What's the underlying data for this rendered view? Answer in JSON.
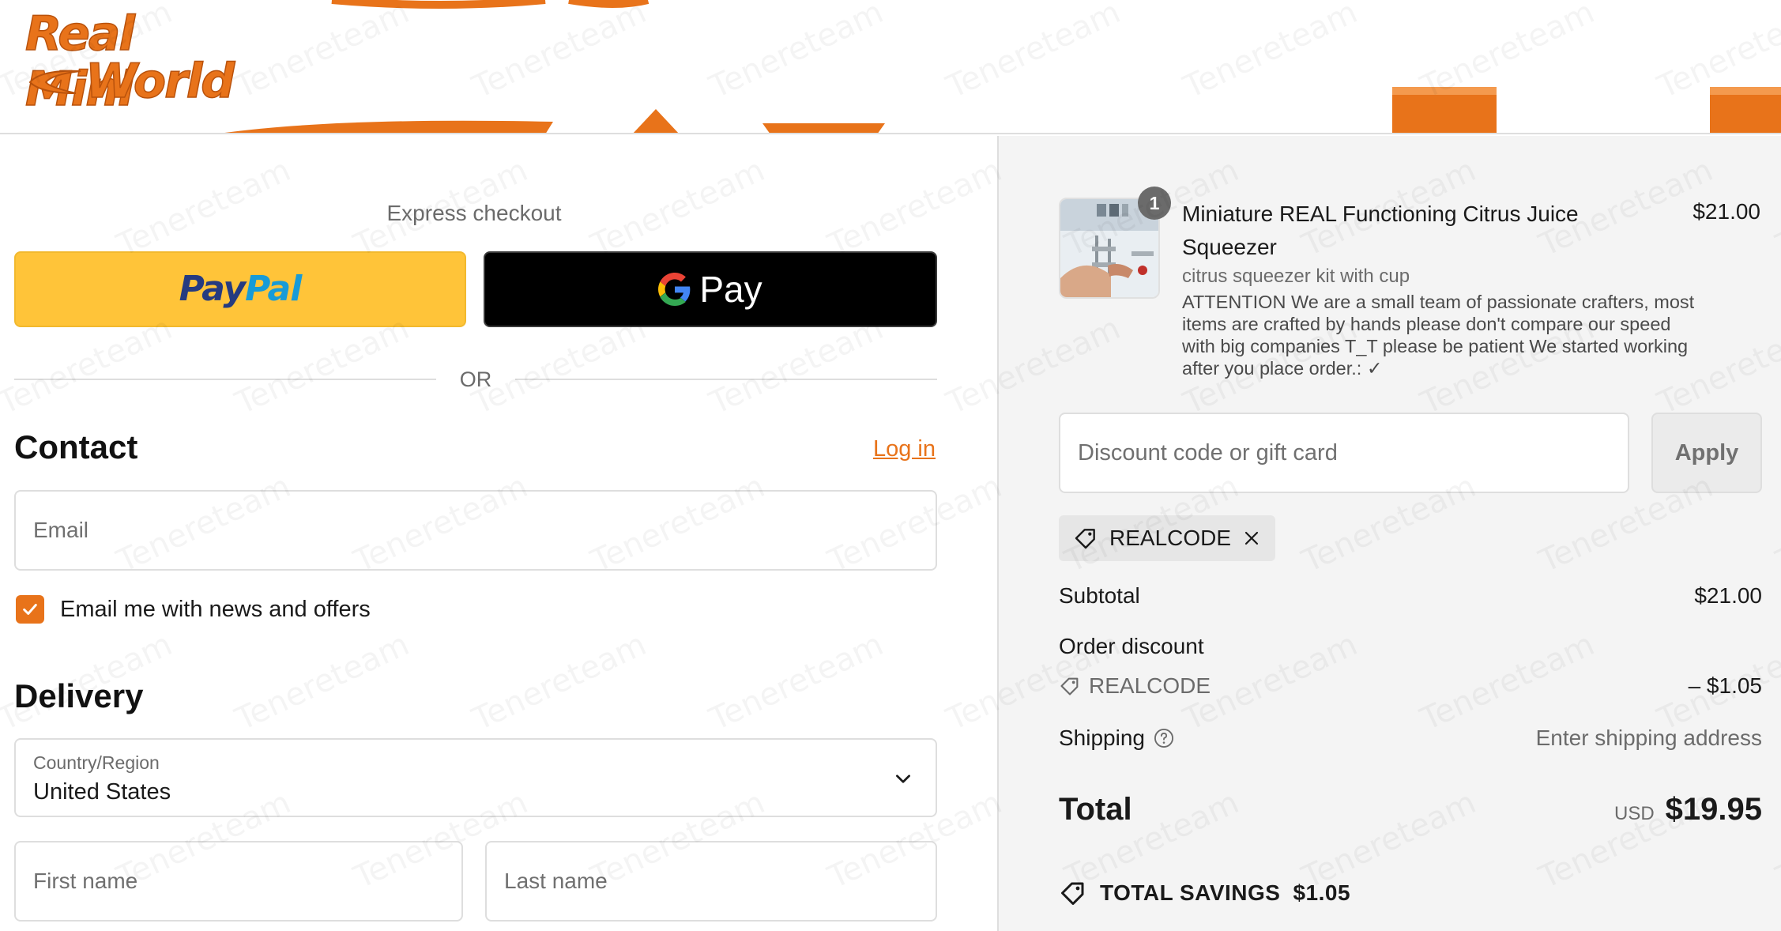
{
  "brand": {
    "logo_line1": "Real Mini",
    "logo_line2": "World",
    "accent_color": "#e8731a"
  },
  "express_checkout": {
    "title": "Express checkout",
    "paypal_label_pay": "Pay",
    "paypal_label_pal": "Pal",
    "gpay_label": "Pay",
    "or_label": "OR"
  },
  "contact": {
    "title": "Contact",
    "login_label": "Log in",
    "email_placeholder": "Email",
    "newsletter_label": "Email me with news and offers",
    "newsletter_checked": true
  },
  "delivery": {
    "title": "Delivery",
    "country_label": "Country/Region",
    "country_value": "United States",
    "first_name_placeholder": "First name",
    "last_name_placeholder": "Last name"
  },
  "order": {
    "product": {
      "title": "Miniature REAL Functioning Citrus Juice Squeezer",
      "price": "$21.00",
      "quantity": "1",
      "variant": "citrus squeezer kit with cup",
      "note": "ATTENTION We are a small team of passionate crafters, most items are crafted by hands please don't compare our speed with big companies T_T please be patient We started working after you place order.: ✓"
    },
    "discount_placeholder": "Discount code or gift card",
    "apply_label": "Apply",
    "applied_code": "REALCODE",
    "subtotal_label": "Subtotal",
    "subtotal_value": "$21.00",
    "order_discount_label": "Order discount",
    "discount_code": "REALCODE",
    "discount_value": "– $1.05",
    "shipping_label": "Shipping",
    "shipping_value": "Enter shipping address",
    "total_label": "Total",
    "total_currency": "USD",
    "total_value": "$19.95",
    "savings_label": "TOTAL SAVINGS",
    "savings_value": "$1.05"
  },
  "watermark_text": "Tenereteam",
  "icons": {
    "tag": "tag-icon",
    "close": "close-icon",
    "help": "help-circle-icon",
    "chevron": "chevron-down-icon",
    "check": "check-icon",
    "google": "google-g-icon"
  }
}
